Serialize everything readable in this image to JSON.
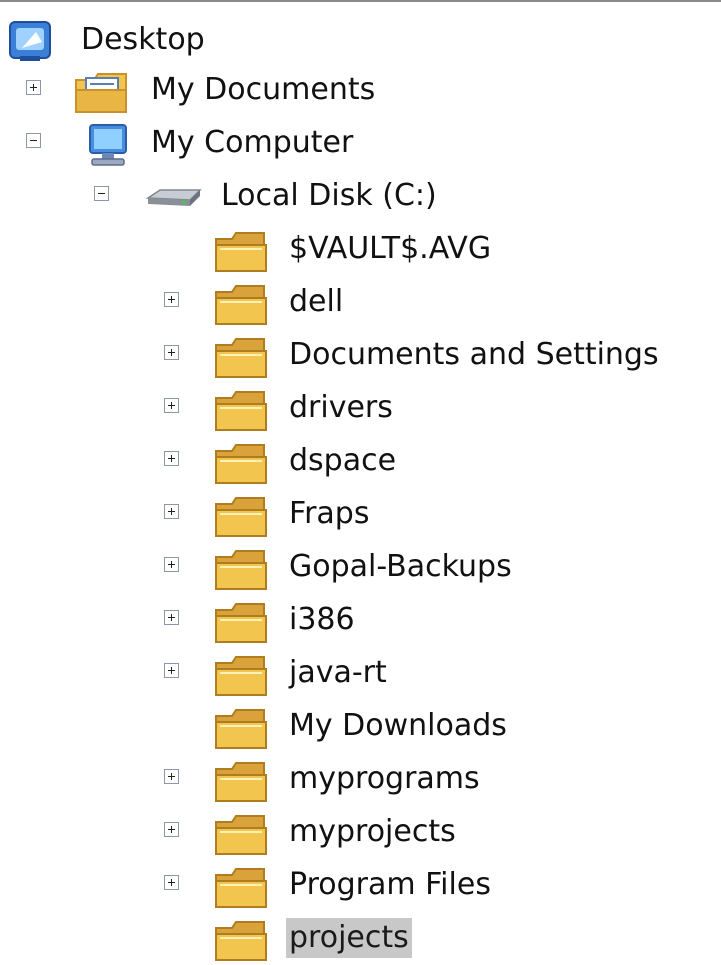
{
  "tree": {
    "desktop": {
      "label": "Desktop",
      "icon": "desktop-icon"
    },
    "my_documents": {
      "label": "My Documents",
      "icon": "my-documents-icon",
      "expander": "plus"
    },
    "my_computer": {
      "label": "My Computer",
      "icon": "my-computer-icon",
      "expander": "minus"
    },
    "local_disk": {
      "label": "Local Disk (C:)",
      "icon": "hard-drive-icon",
      "expander": "minus"
    },
    "folders": [
      {
        "label": "$VAULT$.AVG",
        "expander": "none"
      },
      {
        "label": "dell",
        "expander": "plus"
      },
      {
        "label": "Documents and Settings",
        "expander": "plus"
      },
      {
        "label": "drivers",
        "expander": "plus"
      },
      {
        "label": "dspace",
        "expander": "plus"
      },
      {
        "label": "Fraps",
        "expander": "plus"
      },
      {
        "label": "Gopal-Backups",
        "expander": "plus"
      },
      {
        "label": "i386",
        "expander": "plus"
      },
      {
        "label": "java-rt",
        "expander": "plus"
      },
      {
        "label": "My Downloads",
        "expander": "none"
      },
      {
        "label": "myprograms",
        "expander": "plus"
      },
      {
        "label": "myprojects",
        "expander": "plus"
      },
      {
        "label": "Program Files",
        "expander": "plus"
      },
      {
        "label": "projects",
        "expander": "none",
        "selected": true
      }
    ]
  },
  "colors": {
    "selection": "#c8c8c8",
    "folder": "#f2c54e",
    "folder_shade": "#d9a23a"
  }
}
